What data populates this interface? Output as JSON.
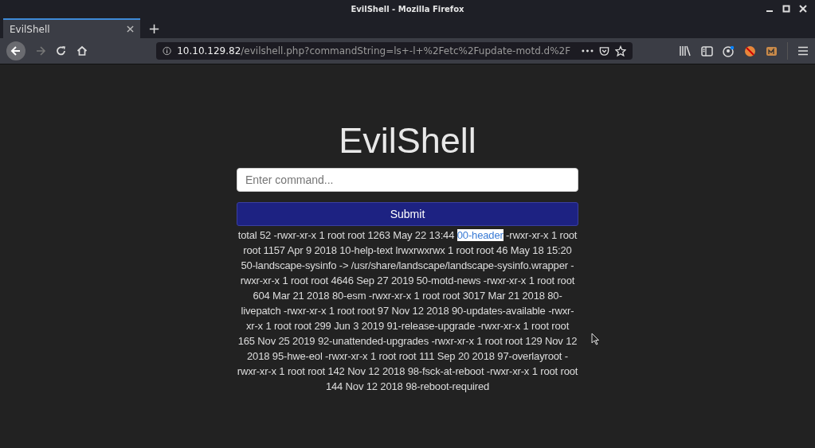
{
  "window": {
    "title": "EvilShell - Mozilla Firefox"
  },
  "tabs": [
    {
      "label": "EvilShell",
      "selected": true
    }
  ],
  "new_tab": {
    "label": "+"
  },
  "address_bar": {
    "host": "10.10.129.82",
    "path": "/evilshell.php?commandString=ls+-l+%2Fetc%2Fupdate-motd.d%2F"
  },
  "page": {
    "heading": "EvilShell",
    "command_field": {
      "placeholder": "Enter command..."
    },
    "submit": "Submit",
    "output": {
      "before": "total 52 -rwxr-xr-x 1 root root 1263 May 22 13:44 ",
      "selected_text": "00-header",
      "after": " -rwxr-xr-x 1 root root 1157 Apr 9 2018 10-help-text lrwxrwxrwx 1 root root 46 May 18 15:20 50-landscape-sysinfo -> /usr/share/landscape/landscape-sysinfo.wrapper -rwxr-xr-x 1 root root 4646 Sep 27 2019 50-motd-news -rwxr-xr-x 1 root root 604 Mar 21 2018 80-esm -rwxr-xr-x 1 root root 3017 Mar 21 2018 80-livepatch -rwxr-xr-x 1 root root 97 Nov 12 2018 90-updates-available -rwxr-xr-x 1 root root 299 Jun 3 2019 91-release-upgrade -rwxr-xr-x 1 root root 165 Nov 25 2019 92-unattended-upgrades -rwxr-xr-x 1 root root 129 Nov 12 2018 95-hwe-eol -rwxr-xr-x 1 root root 111 Sep 20 2018 97-overlayroot -rwxr-xr-x 1 root root 142 Nov 12 2018 98-fsck-at-reboot -rwxr-xr-x 1 root root 144 Nov 12 2018 98-reboot-required"
    }
  }
}
